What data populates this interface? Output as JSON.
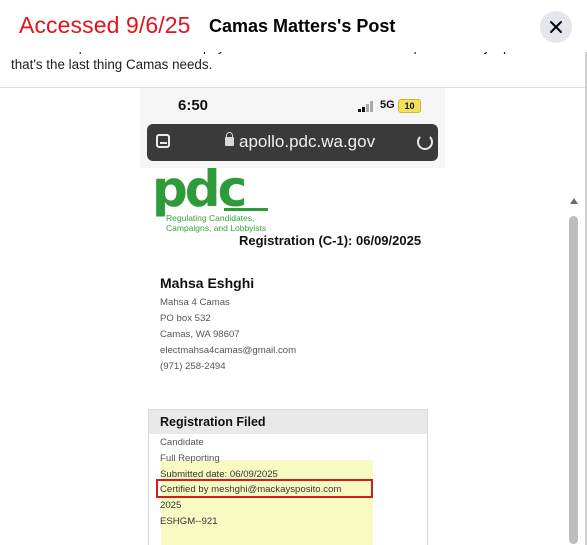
{
  "header": {
    "stamp": "Accessed 9/6/25",
    "title": "Camas Matters's Post",
    "close_label": "close"
  },
  "post": {
    "text": "like an independent voice for taxpayers and more like a rubber stamp for Mackay Sposito. And that's the last thing Camas needs."
  },
  "screenshot": {
    "status": {
      "time": "6:50",
      "network": "5G",
      "battery": "10"
    },
    "browser": {
      "url": "apollo.pdc.wa.gov"
    },
    "logo": {
      "letters": "pdc",
      "tagline_1": "Regulating Candidates,",
      "tagline_2": "Campaigns, and Lobbyists"
    },
    "registration_heading": "Registration (C-1): 06/09/2025",
    "candidate": {
      "name": "Mahsa Eshghi",
      "committee": "Mahsa 4 Camas",
      "address1": "PO box 532",
      "address2": "Camas, WA 98607",
      "email": "electmahsa4camas@gmail.com",
      "phone": "(971) 258-2494"
    },
    "registration_box": {
      "title": "Registration Filed",
      "type": "Candidate",
      "reporting": "Full Reporting",
      "submitted": "Submitted date: 06/09/2025",
      "certified": "Certified by meshghi@mackaysposito.com",
      "year": "2025",
      "filer_id": "ESHGM--921"
    }
  },
  "colors": {
    "stamp_red": "#e0141b",
    "pdc_green": "#2e9b3a",
    "highlight_yellow": "#f8fbc1",
    "annotation_red": "#d81c1c"
  }
}
